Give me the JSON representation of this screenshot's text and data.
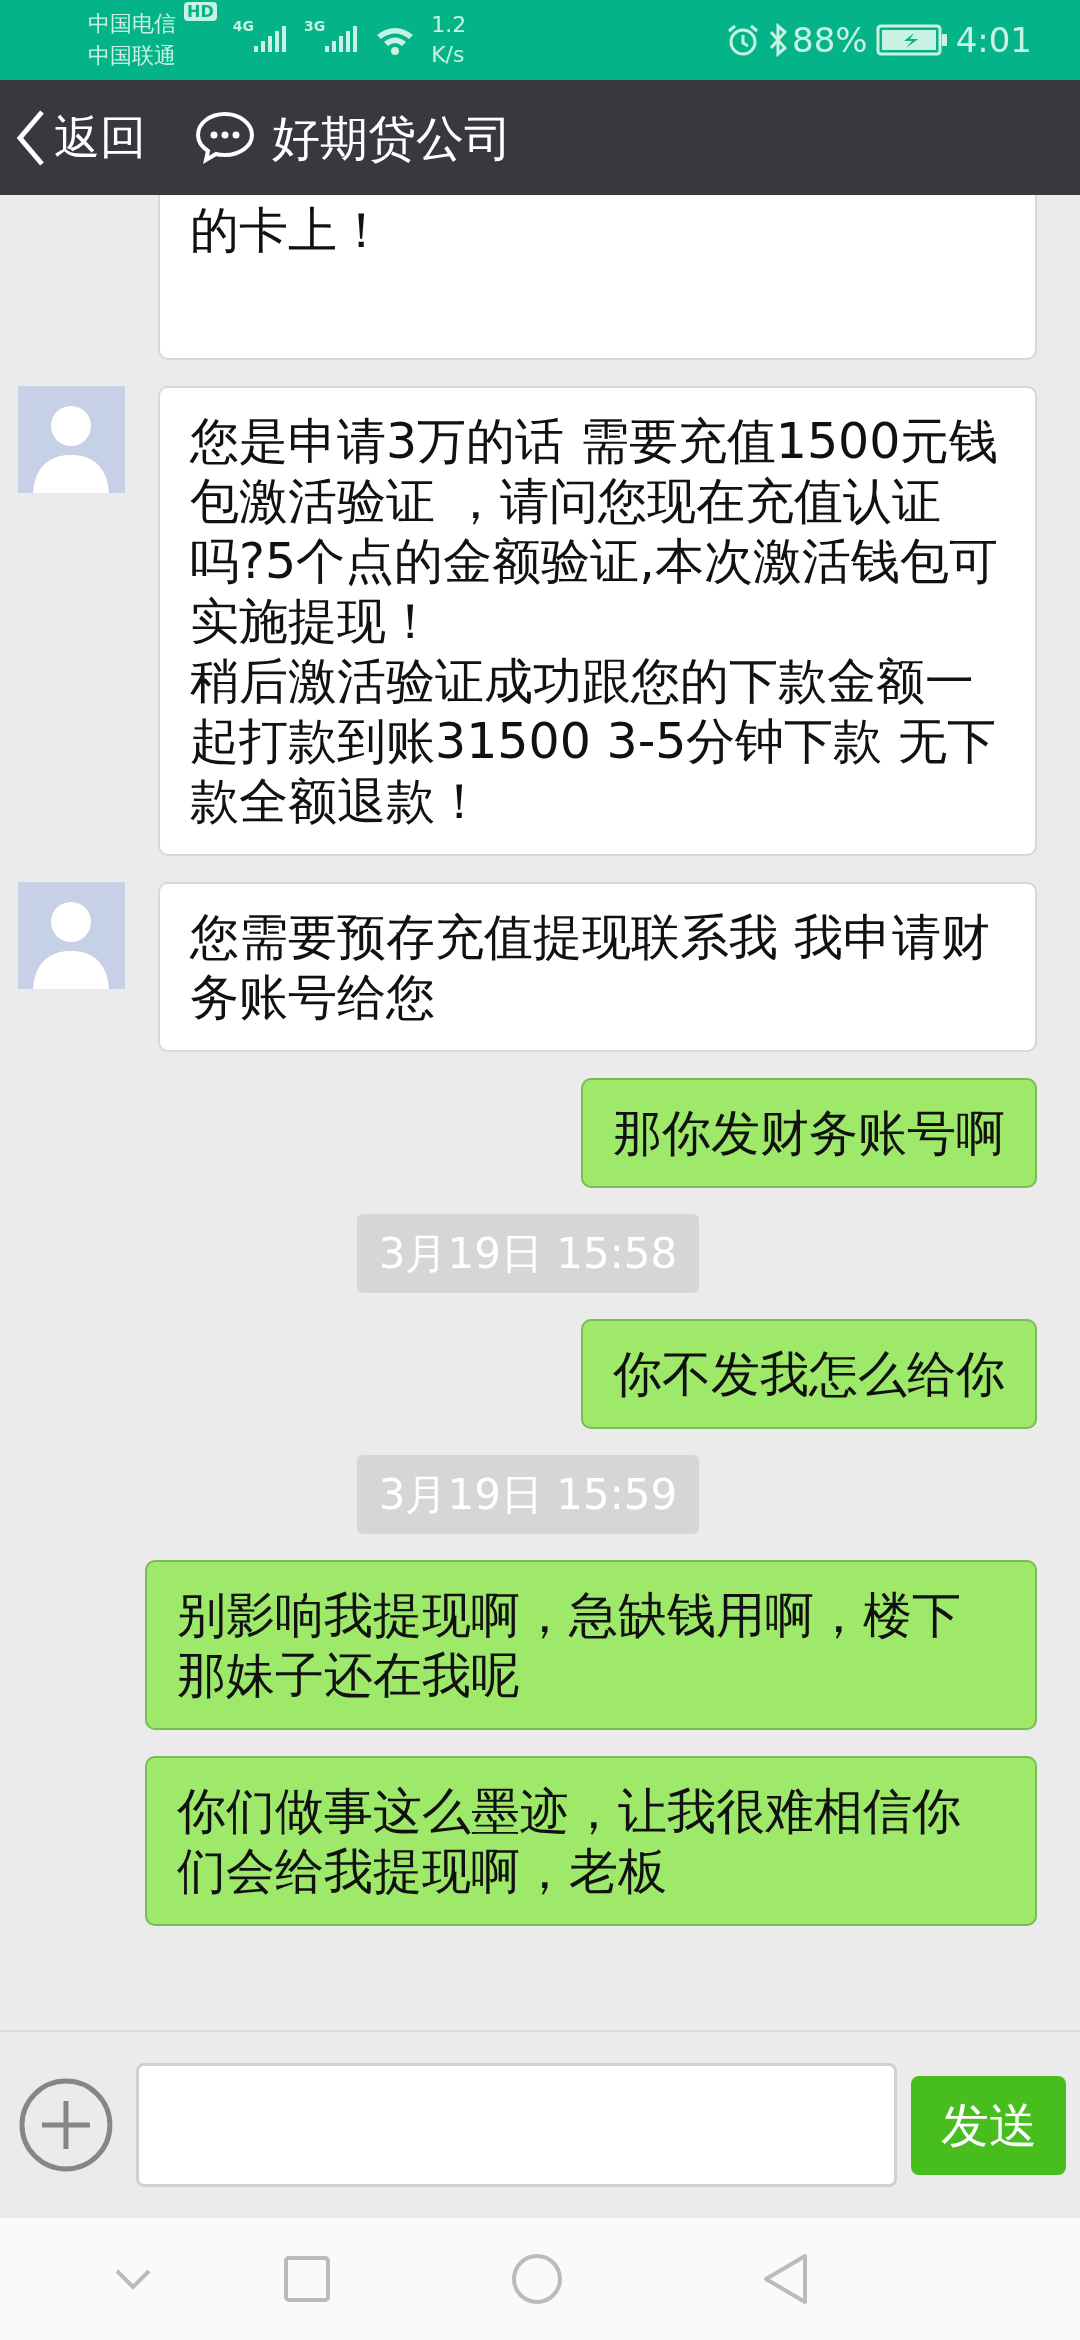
{
  "status_bar": {
    "carriers": [
      "中国电信",
      "中国联通"
    ],
    "hd_badge": "HD",
    "networks": [
      "4G",
      "3G"
    ],
    "speed": [
      "1.2",
      "K/s"
    ],
    "battery": "88%",
    "time": "4:01"
  },
  "header": {
    "back": "返回",
    "title": "好期贷公司"
  },
  "messages": [
    {
      "kind": "incoming",
      "avatar": false,
      "paragraphs": [
        "的卡上！"
      ]
    },
    {
      "kind": "incoming",
      "avatar": true,
      "paragraphs": [
        "您是申请3万的话 需要充值1500元钱包激活验证 ，请问您现在充值认证吗?5个点的金额验证,本次激活钱包可实施提现！",
        "稍后激活验证成功跟您的下款金额一起打款到账31500 3-5分钟下款 无下款全额退款！"
      ]
    },
    {
      "kind": "incoming",
      "avatar": true,
      "paragraphs": [
        "您需要预存充值提现联系我 我申请财务账号给您"
      ]
    },
    {
      "kind": "outgoing",
      "text": "那你发财务账号啊"
    },
    {
      "kind": "time",
      "text": "3月19日 15:58"
    },
    {
      "kind": "outgoing",
      "text": "你不发我怎么给你"
    },
    {
      "kind": "time",
      "text": "3月19日 15:59"
    },
    {
      "kind": "outgoing",
      "text": "别影响我提现啊，急缺钱用啊，楼下那妹子还在我呢"
    },
    {
      "kind": "outgoing",
      "text": "你们做事这么墨迹，让我很难相信你们会给我提现啊，老板"
    }
  ],
  "composer": {
    "send": "发送"
  }
}
